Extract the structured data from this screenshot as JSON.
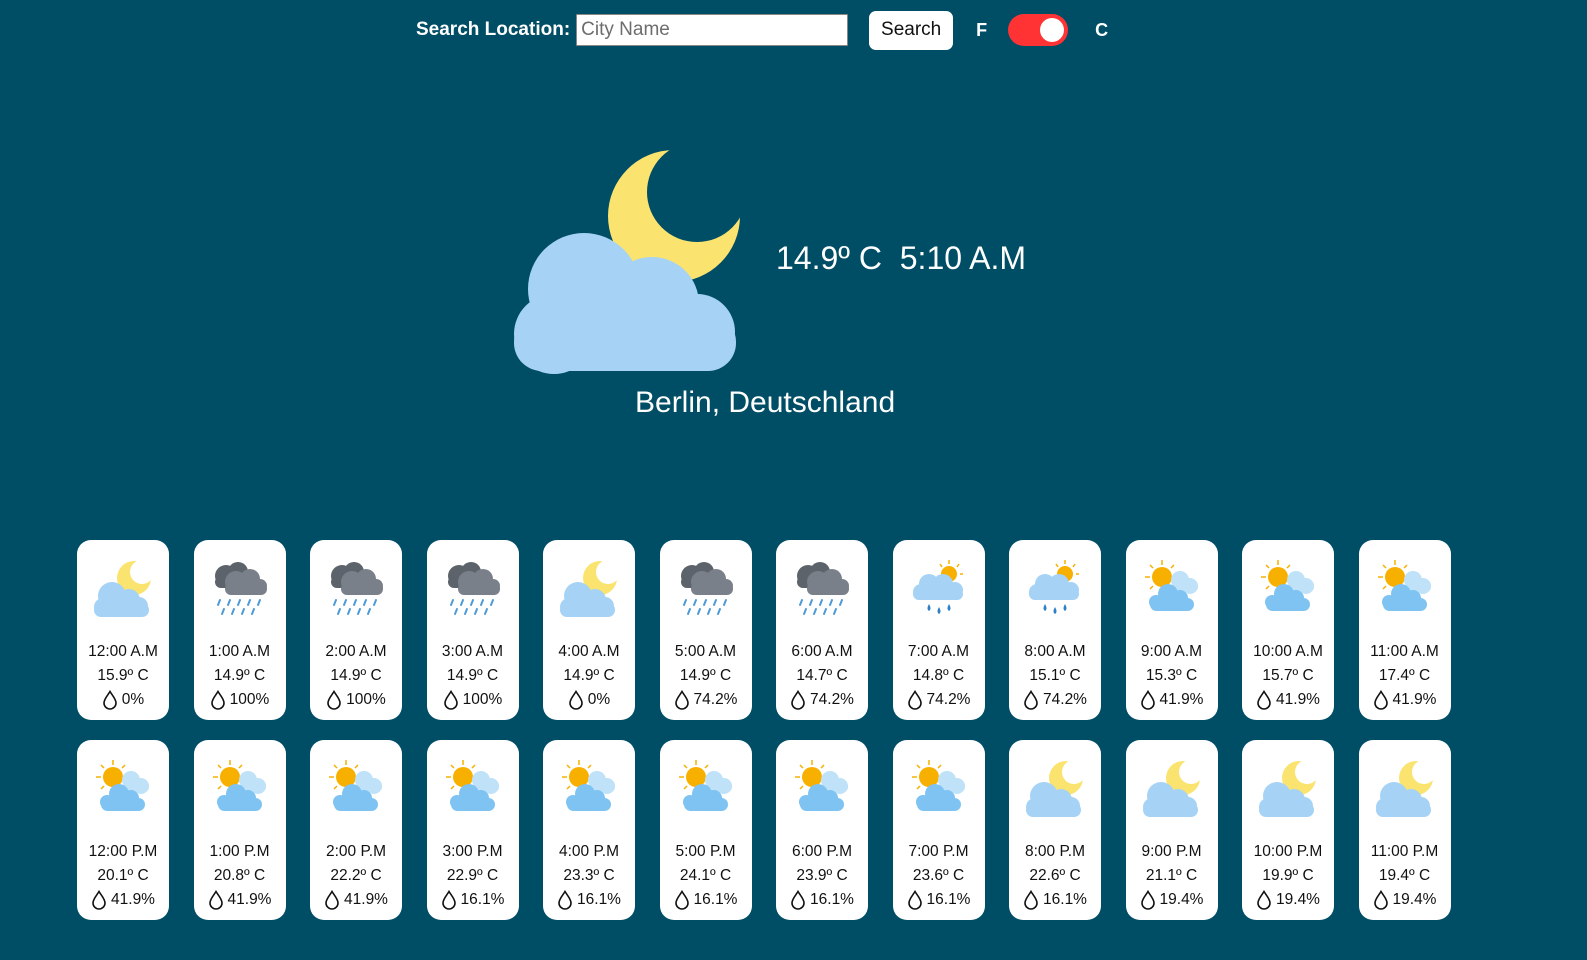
{
  "colors": {
    "background": "#004d66",
    "toggle": "#ff3333",
    "cloud": "#a6d3f5",
    "moon": "#fae36e",
    "sun": "#f7b000",
    "storm_cloud": "#7a8089",
    "rain": "#4d9ad6"
  },
  "search": {
    "label": "Search Location:",
    "placeholder": "City Name",
    "button": "Search"
  },
  "units": {
    "f_label": "F",
    "c_label": "C",
    "selected": "C"
  },
  "current": {
    "icon": "moon-cloud-icon",
    "reading": "14.9º C  5:10 A.M",
    "location": "Berlin, Deutschland"
  },
  "hourly": [
    {
      "time": "12:00 A.M",
      "temp": "15.9º C",
      "humidity": "0%",
      "icon": "moon-cloud-icon"
    },
    {
      "time": "1:00 A.M",
      "temp": "14.9º C",
      "humidity": "100%",
      "icon": "rain-cloud-icon"
    },
    {
      "time": "2:00 A.M",
      "temp": "14.9º C",
      "humidity": "100%",
      "icon": "rain-cloud-icon"
    },
    {
      "time": "3:00 A.M",
      "temp": "14.9º C",
      "humidity": "100%",
      "icon": "rain-cloud-icon"
    },
    {
      "time": "4:00 A.M",
      "temp": "14.9º C",
      "humidity": "0%",
      "icon": "moon-cloud-icon"
    },
    {
      "time": "5:00 A.M",
      "temp": "14.9º C",
      "humidity": "74.2%",
      "icon": "rain-cloud-icon"
    },
    {
      "time": "6:00 A.M",
      "temp": "14.7º C",
      "humidity": "74.2%",
      "icon": "rain-cloud-icon"
    },
    {
      "time": "7:00 A.M",
      "temp": "14.8º C",
      "humidity": "74.2%",
      "icon": "sun-rain-icon"
    },
    {
      "time": "8:00 A.M",
      "temp": "15.1º C",
      "humidity": "74.2%",
      "icon": "sun-rain-icon"
    },
    {
      "time": "9:00 A.M",
      "temp": "15.3º C",
      "humidity": "41.9%",
      "icon": "partly-cloudy-icon"
    },
    {
      "time": "10:00 A.M",
      "temp": "15.7º C",
      "humidity": "41.9%",
      "icon": "partly-cloudy-icon"
    },
    {
      "time": "11:00 A.M",
      "temp": "17.4º C",
      "humidity": "41.9%",
      "icon": "partly-cloudy-icon"
    },
    {
      "time": "12:00 P.M",
      "temp": "20.1º C",
      "humidity": "41.9%",
      "icon": "partly-cloudy-icon"
    },
    {
      "time": "1:00 P.M",
      "temp": "20.8º C",
      "humidity": "41.9%",
      "icon": "partly-cloudy-icon"
    },
    {
      "time": "2:00 P.M",
      "temp": "22.2º C",
      "humidity": "41.9%",
      "icon": "partly-cloudy-icon"
    },
    {
      "time": "3:00 P.M",
      "temp": "22.9º C",
      "humidity": "16.1%",
      "icon": "partly-cloudy-icon"
    },
    {
      "time": "4:00 P.M",
      "temp": "23.3º C",
      "humidity": "16.1%",
      "icon": "partly-cloudy-icon"
    },
    {
      "time": "5:00 P.M",
      "temp": "24.1º C",
      "humidity": "16.1%",
      "icon": "partly-cloudy-icon"
    },
    {
      "time": "6:00 P.M",
      "temp": "23.9º C",
      "humidity": "16.1%",
      "icon": "partly-cloudy-icon"
    },
    {
      "time": "7:00 P.M",
      "temp": "23.6º C",
      "humidity": "16.1%",
      "icon": "partly-cloudy-icon"
    },
    {
      "time": "8:00 P.M",
      "temp": "22.6º C",
      "humidity": "16.1%",
      "icon": "moon-cloud-icon"
    },
    {
      "time": "9:00 P.M",
      "temp": "21.1º C",
      "humidity": "19.4%",
      "icon": "moon-cloud-icon"
    },
    {
      "time": "10:00 P.M",
      "temp": "19.9º C",
      "humidity": "19.4%",
      "icon": "moon-cloud-icon"
    },
    {
      "time": "11:00 P.M",
      "temp": "19.4º C",
      "humidity": "19.4%",
      "icon": "moon-cloud-icon"
    }
  ]
}
